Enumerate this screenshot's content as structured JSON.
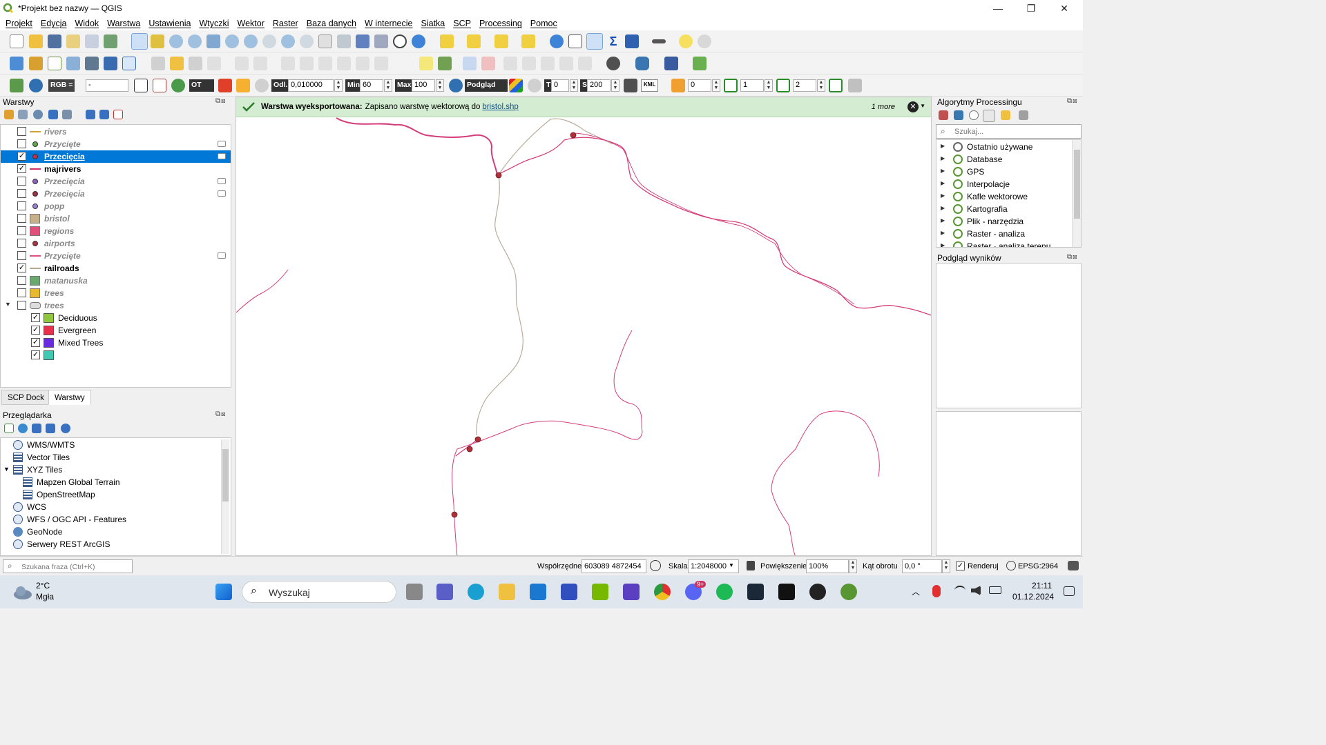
{
  "window": {
    "title": "*Projekt bez nazwy — QGIS",
    "minimize": "—",
    "maximize": "❐",
    "close": "✕"
  },
  "menu": [
    "Projekt",
    "Edycja",
    "Widok",
    "Warstwa",
    "Ustawienia",
    "Wtyczki",
    "Wektor",
    "Raster",
    "Baza danych",
    "W internecie",
    "Siatka",
    "SCP",
    "Processing",
    "Pomoc"
  ],
  "toolbar3": {
    "rgb_label": "RGB =",
    "rgb_value": "-",
    "ot_label": "OT",
    "odl_label": "Odl.",
    "odl_value": "0,010000",
    "min_label": "Min",
    "min_value": "60",
    "max_label": "Max",
    "max_value": "100",
    "podglad_label": "Podgląd",
    "t_label": "T",
    "t_value": "0",
    "s_label": "S",
    "s_value": "200",
    "kml_label": "KML",
    "v1": "0",
    "v2": "1",
    "v3": "2"
  },
  "layers_panel": {
    "title": "Warstwy",
    "layers": [
      {
        "name": "rivers",
        "checked": false,
        "style": "italic",
        "symbol": "line",
        "color": "#d0a030"
      },
      {
        "name": "Przycięte",
        "checked": false,
        "style": "italic",
        "symbol": "point",
        "color": "#5ca84a",
        "flag": true
      },
      {
        "name": "Przecięcia",
        "checked": true,
        "style": "selected",
        "symbol": "point",
        "color": "#c0304a",
        "flag": true
      },
      {
        "name": "majrivers",
        "checked": true,
        "style": "bold",
        "symbol": "line",
        "color": "#d0306a"
      },
      {
        "name": "Przecięcia",
        "checked": false,
        "style": "italic",
        "symbol": "point",
        "color": "#9060c0",
        "flag": true
      },
      {
        "name": "Przecięcia",
        "checked": false,
        "style": "italic",
        "symbol": "point",
        "color": "#a03040",
        "flag": true
      },
      {
        "name": "popp",
        "checked": false,
        "style": "italic",
        "symbol": "point",
        "color": "#9a80d0"
      },
      {
        "name": "bristol",
        "checked": false,
        "style": "italic",
        "symbol": "fill",
        "color": "#c8b08a"
      },
      {
        "name": "regions",
        "checked": false,
        "style": "italic",
        "symbol": "fill",
        "color": "#e0507a"
      },
      {
        "name": "airports",
        "checked": false,
        "style": "italic",
        "symbol": "point",
        "color": "#b03040"
      },
      {
        "name": "Przycięte",
        "checked": false,
        "style": "italic",
        "symbol": "line",
        "color": "#e05080",
        "flag": true
      },
      {
        "name": "railroads",
        "checked": true,
        "style": "bold",
        "symbol": "line",
        "color": "#b8a890"
      },
      {
        "name": "matanuska",
        "checked": false,
        "style": "italic",
        "symbol": "fill",
        "color": "#6aa870"
      },
      {
        "name": "trees",
        "checked": false,
        "style": "italic",
        "symbol": "fill",
        "color": "#e8b830"
      },
      {
        "name": "trees",
        "checked": false,
        "style": "italic",
        "symbol": "group",
        "color": "#dddddd",
        "expanded": true
      }
    ],
    "sublayers": [
      {
        "name": "Deciduous",
        "color": "#8ec63f"
      },
      {
        "name": "Evergreen",
        "color": "#e8304a"
      },
      {
        "name": "Mixed Trees",
        "color": "#6a2ae0"
      },
      {
        "name": "",
        "color": "#40c8b0"
      }
    ]
  },
  "tabs": [
    "SCP Dock",
    "Warstwy"
  ],
  "browser": {
    "title": "Przeglądarka",
    "items": [
      {
        "label": "WMS/WMTS",
        "indent": 0,
        "icon": "globe-icon"
      },
      {
        "label": "Vector Tiles",
        "indent": 0,
        "icon": "grid-icon"
      },
      {
        "label": "XYZ Tiles",
        "indent": 0,
        "icon": "grid-icon",
        "expanded": true
      },
      {
        "label": "Mapzen Global Terrain",
        "indent": 1,
        "icon": "grid-icon"
      },
      {
        "label": "OpenStreetMap",
        "indent": 1,
        "icon": "grid-icon"
      },
      {
        "label": "WCS",
        "indent": 0,
        "icon": "globe-icon"
      },
      {
        "label": "WFS / OGC API - Features",
        "indent": 0,
        "icon": "globe-icon"
      },
      {
        "label": "GeoNode",
        "indent": 0,
        "icon": "geonode-icon"
      },
      {
        "label": "Serwery REST ArcGIS",
        "indent": 0,
        "icon": "globe-icon"
      }
    ]
  },
  "message": {
    "bold": "Warstwa wyeksportowana:",
    "text": "Zapisano warstwę wektorową do",
    "link": "bristol.shp",
    "more": "1 more"
  },
  "processing": {
    "title": "Algorytmy Processingu",
    "search_placeholder": "Szukaj...",
    "items": [
      "Ostatnio używane",
      "Database",
      "GPS",
      "Interpolacje",
      "Kafle wektorowe",
      "Kartografia",
      "Plik - narzędzia",
      "Raster - analiza",
      "Raster - analiza terenu"
    ]
  },
  "results": {
    "title": "Podgląd wyników"
  },
  "statusbar": {
    "search_placeholder": "Szukana fraza (Ctrl+K)",
    "coord_label": "Współrzędne",
    "coord_value": "603089 4872454",
    "scale_label": "Skala",
    "scale_value": "1:2048000",
    "zoom_label": "Powiększenie",
    "zoom_value": "100%",
    "rotation_label": "Kąt obrotu",
    "rotation_value": "0,0 °",
    "render_label": "Renderuj",
    "crs": "EPSG:2964"
  },
  "taskbar": {
    "temp": "2°C",
    "weather": "Mgła",
    "search": "Wyszukaj",
    "time": "21:11",
    "date": "01.12.2024",
    "discord_badge": "9+"
  }
}
